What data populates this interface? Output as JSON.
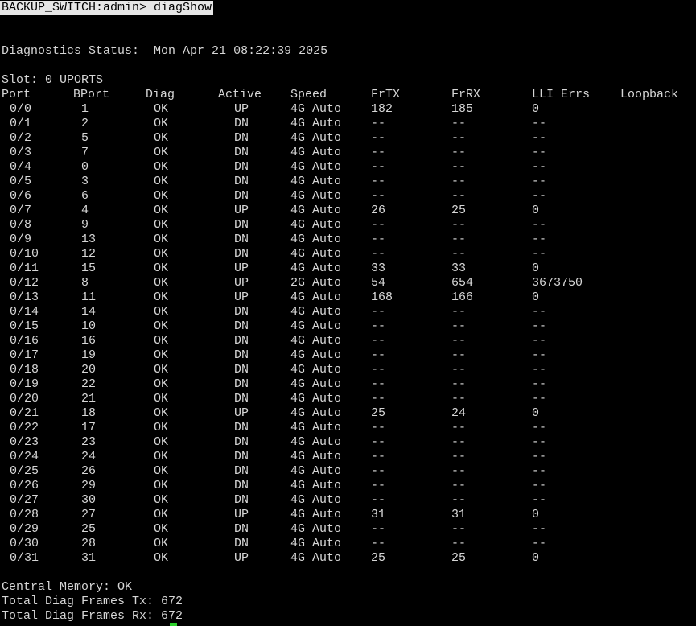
{
  "terminal": {
    "prompt": "BACKUP_SWITCH:admin>",
    "command": "diagShow",
    "status_label": "Diagnostics Status:",
    "status_time": "Mon Apr 21 08:22:39 2025",
    "slot_line": "Slot: 0 UPORTS",
    "cursor_color": "#2bd12b"
  },
  "table": {
    "headers": [
      "Port",
      "BPort",
      "Diag",
      "Active",
      "Speed",
      "FrTX",
      "FrRX",
      "LLI Errs",
      "Loopback"
    ],
    "rows": [
      [
        "0/0",
        "1",
        "OK",
        "UP",
        "4G Auto",
        "182",
        "185",
        "0"
      ],
      [
        "0/1",
        "2",
        "OK",
        "DN",
        "4G Auto",
        "--",
        "--",
        "--"
      ],
      [
        "0/2",
        "5",
        "OK",
        "DN",
        "4G Auto",
        "--",
        "--",
        "--"
      ],
      [
        "0/3",
        "7",
        "OK",
        "DN",
        "4G Auto",
        "--",
        "--",
        "--"
      ],
      [
        "0/4",
        "0",
        "OK",
        "DN",
        "4G Auto",
        "--",
        "--",
        "--"
      ],
      [
        "0/5",
        "3",
        "OK",
        "DN",
        "4G Auto",
        "--",
        "--",
        "--"
      ],
      [
        "0/6",
        "6",
        "OK",
        "DN",
        "4G Auto",
        "--",
        "--",
        "--"
      ],
      [
        "0/7",
        "4",
        "OK",
        "UP",
        "4G Auto",
        "26",
        "25",
        "0"
      ],
      [
        "0/8",
        "9",
        "OK",
        "DN",
        "4G Auto",
        "--",
        "--",
        "--"
      ],
      [
        "0/9",
        "13",
        "OK",
        "DN",
        "4G Auto",
        "--",
        "--",
        "--"
      ],
      [
        "0/10",
        "12",
        "OK",
        "DN",
        "4G Auto",
        "--",
        "--",
        "--"
      ],
      [
        "0/11",
        "15",
        "OK",
        "UP",
        "4G Auto",
        "33",
        "33",
        "0"
      ],
      [
        "0/12",
        "8",
        "OK",
        "UP",
        "2G Auto",
        "54",
        "654",
        "3673750"
      ],
      [
        "0/13",
        "11",
        "OK",
        "UP",
        "4G Auto",
        "168",
        "166",
        "0"
      ],
      [
        "0/14",
        "14",
        "OK",
        "DN",
        "4G Auto",
        "--",
        "--",
        "--"
      ],
      [
        "0/15",
        "10",
        "OK",
        "DN",
        "4G Auto",
        "--",
        "--",
        "--"
      ],
      [
        "0/16",
        "16",
        "OK",
        "DN",
        "4G Auto",
        "--",
        "--",
        "--"
      ],
      [
        "0/17",
        "19",
        "OK",
        "DN",
        "4G Auto",
        "--",
        "--",
        "--"
      ],
      [
        "0/18",
        "20",
        "OK",
        "DN",
        "4G Auto",
        "--",
        "--",
        "--"
      ],
      [
        "0/19",
        "22",
        "OK",
        "DN",
        "4G Auto",
        "--",
        "--",
        "--"
      ],
      [
        "0/20",
        "21",
        "OK",
        "DN",
        "4G Auto",
        "--",
        "--",
        "--"
      ],
      [
        "0/21",
        "18",
        "OK",
        "UP",
        "4G Auto",
        "25",
        "24",
        "0"
      ],
      [
        "0/22",
        "17",
        "OK",
        "DN",
        "4G Auto",
        "--",
        "--",
        "--"
      ],
      [
        "0/23",
        "23",
        "OK",
        "DN",
        "4G Auto",
        "--",
        "--",
        "--"
      ],
      [
        "0/24",
        "24",
        "OK",
        "DN",
        "4G Auto",
        "--",
        "--",
        "--"
      ],
      [
        "0/25",
        "26",
        "OK",
        "DN",
        "4G Auto",
        "--",
        "--",
        "--"
      ],
      [
        "0/26",
        "29",
        "OK",
        "DN",
        "4G Auto",
        "--",
        "--",
        "--"
      ],
      [
        "0/27",
        "30",
        "OK",
        "DN",
        "4G Auto",
        "--",
        "--",
        "--"
      ],
      [
        "0/28",
        "27",
        "OK",
        "UP",
        "4G Auto",
        "31",
        "31",
        "0"
      ],
      [
        "0/29",
        "25",
        "OK",
        "DN",
        "4G Auto",
        "--",
        "--",
        "--"
      ],
      [
        "0/30",
        "28",
        "OK",
        "DN",
        "4G Auto",
        "--",
        "--",
        "--"
      ],
      [
        "0/31",
        "31",
        "OK",
        "UP",
        "4G Auto",
        "25",
        "25",
        "0"
      ]
    ]
  },
  "footer": {
    "central_memory": "Central Memory: OK",
    "frames_tx": "Total Diag Frames Tx: 672",
    "frames_rx": "Total Diag Frames Rx: 672"
  }
}
